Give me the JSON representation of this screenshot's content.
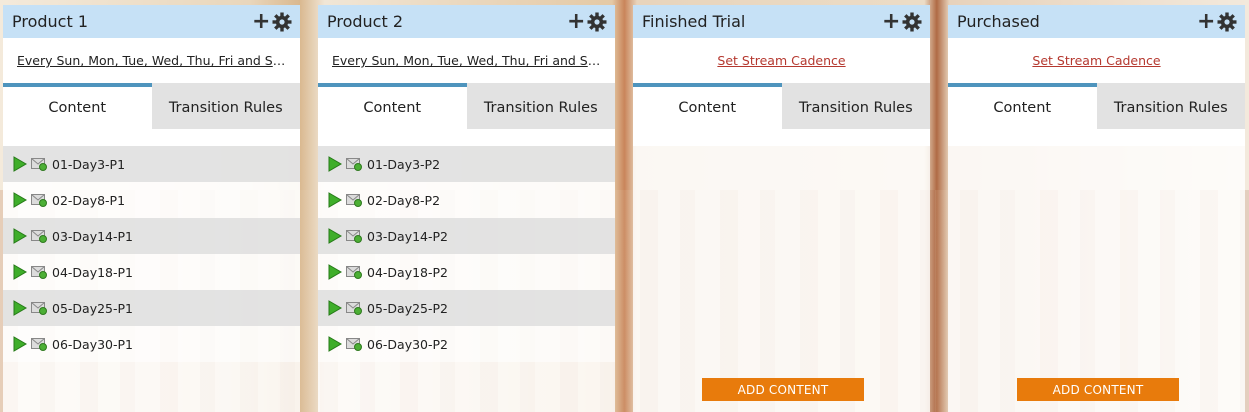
{
  "columns": [
    {
      "title": "Product 1",
      "cadence": "Every Sun, Mon, Tue, Wed, Thu, Fri and Sat ...",
      "cadence_style": "plain",
      "tabs": [
        "Content",
        "Transition Rules"
      ],
      "items": [
        "01-Day3-P1",
        "02-Day8-P1",
        "03-Day14-P1",
        "04-Day18-P1",
        "05-Day25-P1",
        "06-Day30-P1"
      ],
      "add_button": ""
    },
    {
      "title": "Product 2",
      "cadence": "Every Sun, Mon, Tue, Wed, Thu, Fri and Sat ...",
      "cadence_style": "plain",
      "tabs": [
        "Content",
        "Transition Rules"
      ],
      "items": [
        "01-Day3-P2",
        "02-Day8-P2",
        "03-Day14-P2",
        "04-Day18-P2",
        "05-Day25-P2",
        "06-Day30-P2"
      ],
      "add_button": ""
    },
    {
      "title": "Finished Trial",
      "cadence": "Set Stream Cadence",
      "cadence_style": "red",
      "tabs": [
        "Content",
        "Transition Rules"
      ],
      "items": [],
      "add_button": "ADD CONTENT"
    },
    {
      "title": "Purchased",
      "cadence": "Set Stream Cadence",
      "cadence_style": "red",
      "tabs": [
        "Content",
        "Transition Rules"
      ],
      "items": [],
      "add_button": "ADD CONTENT"
    }
  ],
  "icons": {
    "add": "plus-icon",
    "settings": "gear-icon",
    "play": "play-icon",
    "email": "email-icon"
  },
  "colors": {
    "header": "#c6e1f6",
    "active_tab_border": "#4e94bd",
    "add_button": "#e87b0c",
    "cadence_link_red": "#b5382f"
  }
}
